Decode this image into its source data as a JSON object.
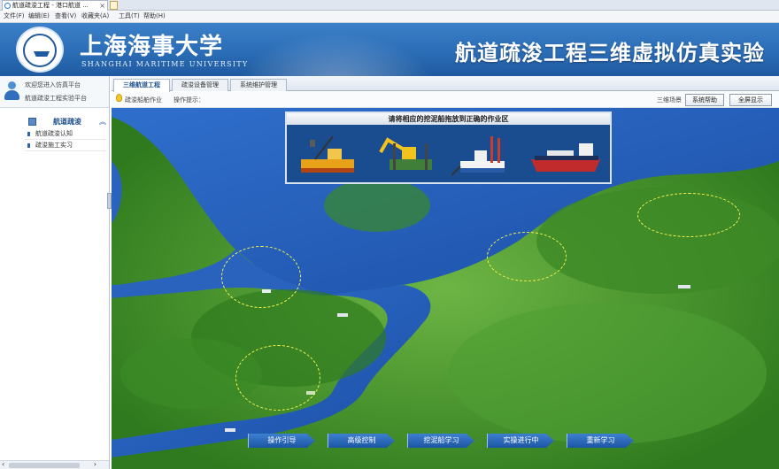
{
  "browser": {
    "tab_title": "航道疏浚工程 - 港口航道 ...",
    "menu": [
      "文件(F)",
      "编辑(E)",
      "查看(V)",
      "收藏夹(A)",
      "工具(T)",
      "帮助(H)"
    ]
  },
  "header": {
    "university_cn": "上海海事大学",
    "university_en": "SHANGHAI MARITIME UNIVERSITY",
    "app_title": "航道疏浚工程三维虚拟仿真实验",
    "accent_color": "#2b6db6"
  },
  "sidebar": {
    "user_line1": "欢迎您进入仿真平台",
    "user_line2": "航道疏浚工程实验平台",
    "course_label": "航道疏浚",
    "items": [
      {
        "label": "航道疏浚认知"
      },
      {
        "label": "疏浚施工实习"
      }
    ]
  },
  "content_tabs": [
    {
      "label": "三维航道工程",
      "active": true
    },
    {
      "label": "疏浚设备管理",
      "active": false
    },
    {
      "label": "系统维护管理",
      "active": false
    }
  ],
  "toolbar": {
    "hint_label": "疏浚船舶作业",
    "hint_status": "操作提示：",
    "right_label": "三维场景",
    "btn_settings": "系统帮助",
    "btn_fullscreen": "全屏显示"
  },
  "scene": {
    "prompt_title": "请将相应的挖泥船拖放到正确的作业区",
    "vessels": [
      {
        "name": "grab-dredger"
      },
      {
        "name": "backhoe-dredger"
      },
      {
        "name": "cutter-suction-dredger"
      },
      {
        "name": "trailing-suction-hopper-dredger"
      }
    ],
    "buttons": [
      "操作引导",
      "高级控制",
      "挖泥船学习",
      "实操进行中",
      "重新学习"
    ]
  }
}
